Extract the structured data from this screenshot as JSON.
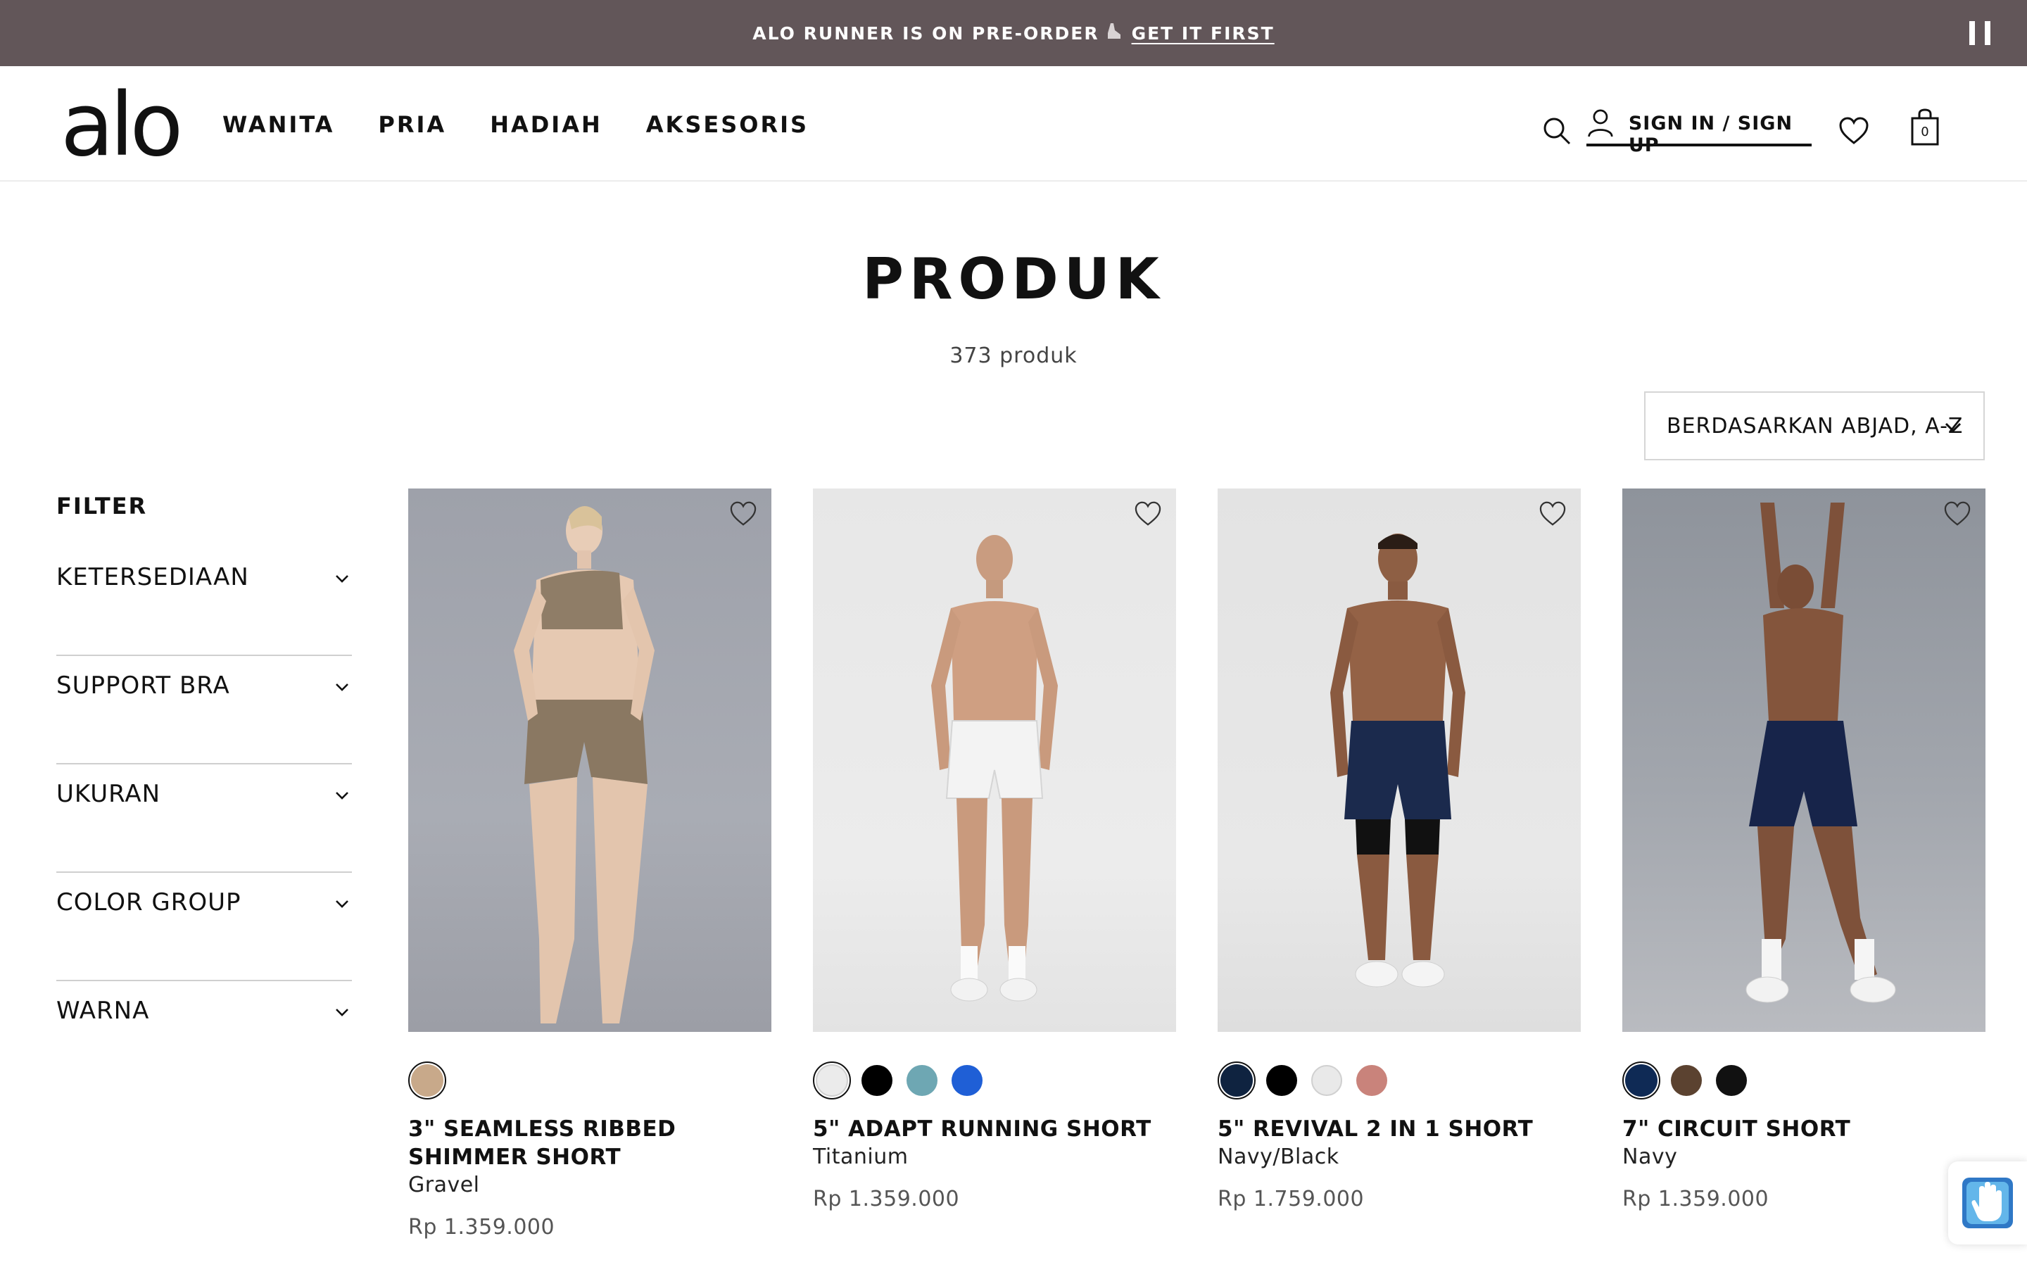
{
  "announcement": {
    "text": "ALO RUNNER IS ON PRE-ORDER",
    "icon": "shoe-icon",
    "link_label": "GET IT FIRST",
    "bg_color": "#625659"
  },
  "header": {
    "logo": "alo",
    "nav": [
      "WANITA",
      "PRIA",
      "HADIAH",
      "AKSESORIS"
    ],
    "sign_in_label": "SIGN IN / SIGN UP",
    "cart_count": "0"
  },
  "main": {
    "title": "PRODUK",
    "count": "373 produk",
    "sort_label": "BERDASARKAN ABJAD, A-Z"
  },
  "filter": {
    "title": "FILTER",
    "items": [
      "KETERSEDIAAN",
      "SUPPORT BRA",
      "UKURAN",
      "COLOR GROUP",
      "WARNA"
    ]
  },
  "products": [
    {
      "name": "3\" SEAMLESS RIBBED SHIMMER SHORT",
      "color": "Gravel",
      "price": "Rp 1.359.000",
      "swatches": [
        "#c8a98a"
      ],
      "selected_swatch": 0
    },
    {
      "name": "5\" ADAPT RUNNING SHORT",
      "color": "Titanium",
      "price": "Rp 1.359.000",
      "swatches": [
        "#ebebeb",
        "#000000",
        "#6ea7b3",
        "#1f5fd6"
      ],
      "selected_swatch": 0
    },
    {
      "name": "5\" REVIVAL 2 IN 1 SHORT",
      "color": "Navy/Black",
      "price": "Rp 1.759.000",
      "swatches": [
        "#0f2340",
        "#000000",
        "#e9e9e9",
        "#c9837b"
      ],
      "selected_swatch": 0
    },
    {
      "name": "7\" CIRCUIT SHORT",
      "color": "Navy",
      "price": "Rp 1.359.000",
      "swatches": [
        "#0f2a55",
        "#5b4230",
        "#111111"
      ],
      "selected_swatch": 0
    }
  ],
  "accessibility_widget": {
    "icon": "accessibility-hand-icon"
  }
}
